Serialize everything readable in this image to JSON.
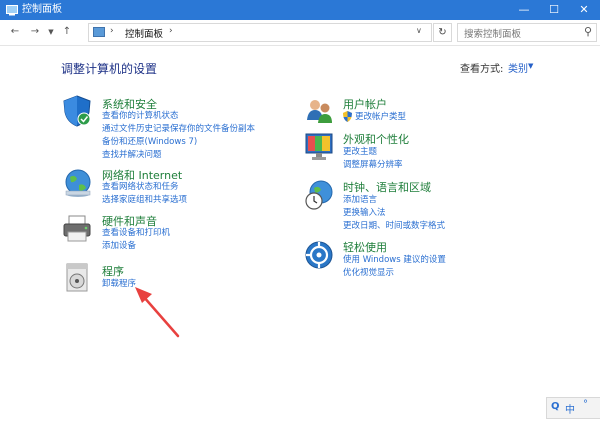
{
  "window": {
    "title": "控制面板"
  },
  "address": {
    "breadcrumb": "控制面板",
    "search_placeholder": "搜索控制面板"
  },
  "content": {
    "heading": "调整计算机的设置",
    "view_by_label": "查看方式:",
    "view_by_value": "类别"
  },
  "categories": {
    "system": {
      "title": "系统和安全",
      "links": [
        "查看你的计算机状态",
        "通过文件历史记录保存你的文件备份副本",
        "备份和还原(Windows 7)",
        "查找并解决问题"
      ]
    },
    "network": {
      "title": "网络和 Internet",
      "links": [
        "查看网络状态和任务",
        "选择家庭组和共享选项"
      ]
    },
    "hardware": {
      "title": "硬件和声音",
      "links": [
        "查看设备和打印机",
        "添加设备"
      ]
    },
    "programs": {
      "title": "程序",
      "links": [
        "卸载程序"
      ]
    },
    "users": {
      "title": "用户帐户",
      "links": [
        "更改帐户类型"
      ]
    },
    "appearance": {
      "title": "外观和个性化",
      "links": [
        "更改主题",
        "调整屏幕分辨率"
      ]
    },
    "clock": {
      "title": "时钟、语言和区域",
      "links": [
        "添加语言",
        "更换输入法",
        "更改日期、时间或数字格式"
      ]
    },
    "access": {
      "title": "轻松使用",
      "links": [
        "使用 Windows 建议的设置",
        "优化视觉显示"
      ]
    }
  },
  "ime": {
    "items": [
      "Q",
      "中",
      "°"
    ]
  },
  "colors": {
    "titlebar": "#2b78d6",
    "link": "#2a6fd1",
    "category": "#1e7e3a",
    "heading": "#1e3287",
    "arrow": "#e8413f"
  }
}
